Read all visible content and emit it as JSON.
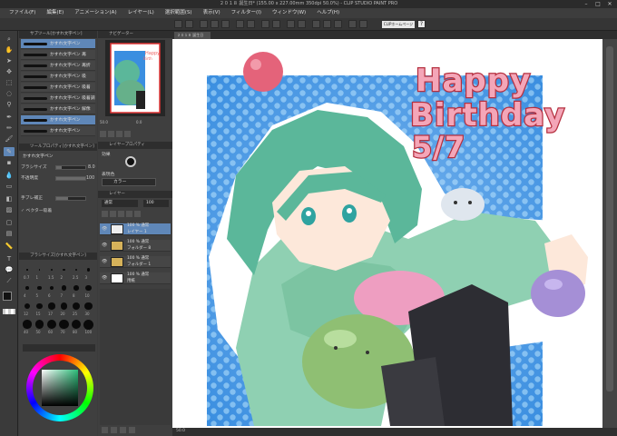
{
  "titlebar": {
    "title": "２０１８ 誕生日* (155.00 x 227.00mm 350dpi 50.0%) - CLIP STUDIO PAINT PRO"
  },
  "menubar": {
    "items": [
      "ファイル(F)",
      "編集(E)",
      "アニメーション(A)",
      "レイヤー(L)",
      "選択範囲(S)",
      "表示(V)",
      "フィルター(I)",
      "ウィンドウ(W)",
      "ヘルプ(H)"
    ]
  },
  "cmdbar": {
    "clip_button": "CLIPホームページ",
    "help_button": "?"
  },
  "subtool": {
    "header": "サブツール[かすれ文字ペン]",
    "brushes": [
      {
        "label": "かすれ文字ペン"
      },
      {
        "label": "かすれ文字ペン 再"
      },
      {
        "label": "かすれ文字ペン 再折"
      },
      {
        "label": "かすれ文字ペン 吸"
      },
      {
        "label": "かすれ文字ペン 吸着"
      },
      {
        "label": "かすれ文字ペン 吸着調"
      },
      {
        "label": "かすれ文字ペン 解像"
      },
      {
        "label": "かすれ文字ペン"
      },
      {
        "label": "かすれ文字ペン"
      }
    ],
    "prop_header": "ツールプロパティ[かすれ文字ペン]",
    "prop_sub": "かすれ文字ペン",
    "props": [
      {
        "label": "ブラシサイズ",
        "value": "8.0",
        "level": 0.2
      },
      {
        "label": "不透明度",
        "value": "100",
        "level": 1.0
      },
      {
        "label": "手ブレ補正",
        "value": "",
        "level": 0.4
      },
      {
        "label": "ベクター吸着",
        "value": "",
        "level": 0
      }
    ],
    "size_header": "ブラシサイズ[かすれ文字ペン]",
    "sizes": [
      "0.7",
      "1",
      "1.5",
      "2",
      "2.5",
      "3",
      "4",
      "5",
      "6",
      "7",
      "8",
      "10",
      "12",
      "15",
      "17",
      "20",
      "25",
      "30",
      "40",
      "50",
      "60",
      "70",
      "80",
      "100"
    ]
  },
  "navigator": {
    "header": "ナビゲーター",
    "zoom": "50.0",
    "angle": "0.0"
  },
  "layer_property": {
    "header": "レイヤープロパティ",
    "effect": "効果",
    "expression_label": "表現色",
    "expression_value": "カラー"
  },
  "layers": {
    "header": "レイヤー",
    "blend": "通常",
    "opacity": "100",
    "rows": [
      {
        "top": "100 % 通常",
        "bottom": "レイヤー 1"
      },
      {
        "top": "100 % 通常",
        "bottom": "フォルダー 8"
      },
      {
        "top": "100 % 通常",
        "bottom": "フォルダー 1"
      },
      {
        "top": "100 % 通常",
        "bottom": "用紙"
      }
    ]
  },
  "canvas": {
    "tab": "２０１８ 誕生日",
    "text1": "Happy",
    "text2": "Birthday",
    "text3": "5/7"
  },
  "statusbar": {
    "zoom": "50.0"
  },
  "colors": {
    "accent": "#5f87b8",
    "panel": "#3f3f3f",
    "dots_bg": "#3a8ee0",
    "hair": "#5bb79a",
    "title_fill": "#f4a6b8",
    "title_stroke": "#b5303f"
  }
}
